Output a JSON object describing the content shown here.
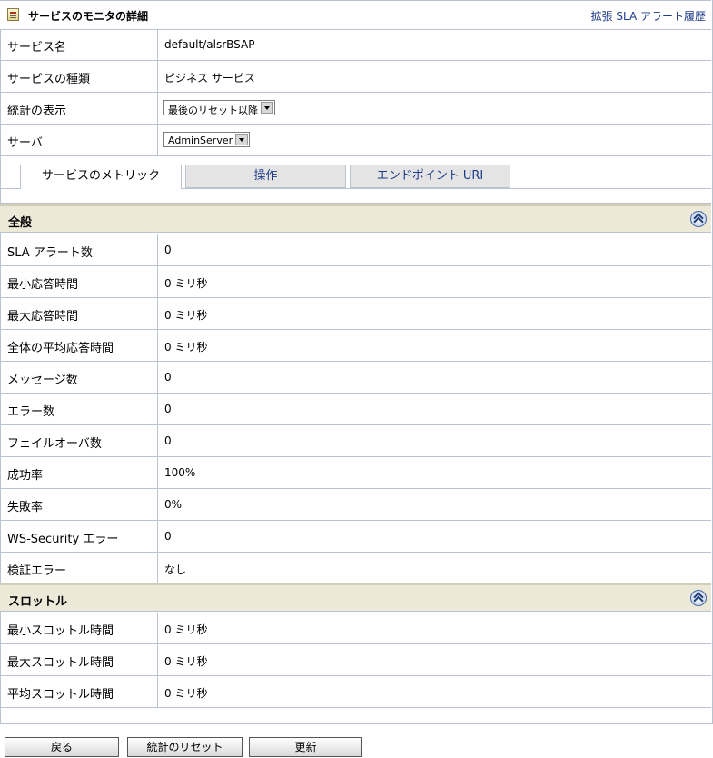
{
  "header": {
    "title": "サービスのモニタの詳細",
    "link": "拡張 SLA アラート履歴"
  },
  "info": {
    "service_name_label": "サービス名",
    "service_name_value": "default/alsrBSAP",
    "service_type_label": "サービスの種類",
    "service_type_value": "ビジネス サービス",
    "stats_label": "統計の表示",
    "stats_select": "最後のリセット以降",
    "server_label": "サーバ",
    "server_select": "AdminServer"
  },
  "tabs": [
    "サービスのメトリック",
    "操作",
    "エンドポイント URI"
  ],
  "general": {
    "title": "全般",
    "rows": [
      {
        "label": "SLA アラート数",
        "value": "0"
      },
      {
        "label": "最小応答時間",
        "value": "0 ミリ秒"
      },
      {
        "label": "最大応答時間",
        "value": "0 ミリ秒"
      },
      {
        "label": "全体の平均応答時間",
        "value": "0 ミリ秒"
      },
      {
        "label": "メッセージ数",
        "value": "0"
      },
      {
        "label": "エラー数",
        "value": "0"
      },
      {
        "label": "フェイルオーバ数",
        "value": "0"
      },
      {
        "label": "成功率",
        "value": "100%"
      },
      {
        "label": "失敗率",
        "value": "0%"
      },
      {
        "label": "WS-Security エラー",
        "value": "0"
      },
      {
        "label": "検証エラー",
        "value": "なし"
      }
    ]
  },
  "throttle": {
    "title": "スロットル",
    "rows": [
      {
        "label": "最小スロットル時間",
        "value": "0 ミリ秒"
      },
      {
        "label": "最大スロットル時間",
        "value": "0 ミリ秒"
      },
      {
        "label": "平均スロットル時間",
        "value": "0 ミリ秒"
      }
    ]
  },
  "buttons": {
    "back": "戻る",
    "reset": "統計のリセット",
    "refresh": "更新"
  },
  "icons": {
    "title_icon": "monitor-detail-icon",
    "collapse": "double-chevron-up-icon"
  }
}
